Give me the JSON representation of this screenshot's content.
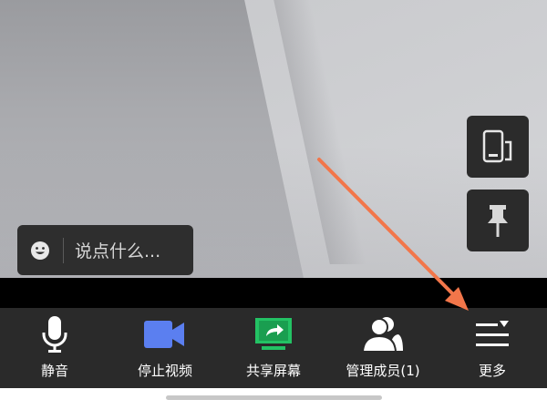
{
  "chat": {
    "placeholder": "说点什么..."
  },
  "toolbar": {
    "items": [
      {
        "label": "静音",
        "icon": "microphone-icon"
      },
      {
        "label": "停止视频",
        "icon": "video-camera-icon"
      },
      {
        "label": "共享屏幕",
        "icon": "share-screen-icon"
      },
      {
        "label": "管理成员(1)",
        "icon": "members-icon"
      },
      {
        "label": "更多",
        "icon": "more-menu-icon"
      }
    ]
  },
  "side_buttons": {
    "rotate": "rotate-screen-icon",
    "pin": "pin-icon"
  },
  "colors": {
    "toolbar_bg": "#2a2a2a",
    "camera_blue": "#5b7ff0",
    "share_green": "#23c264",
    "annotation_arrow": "#f2764a"
  }
}
